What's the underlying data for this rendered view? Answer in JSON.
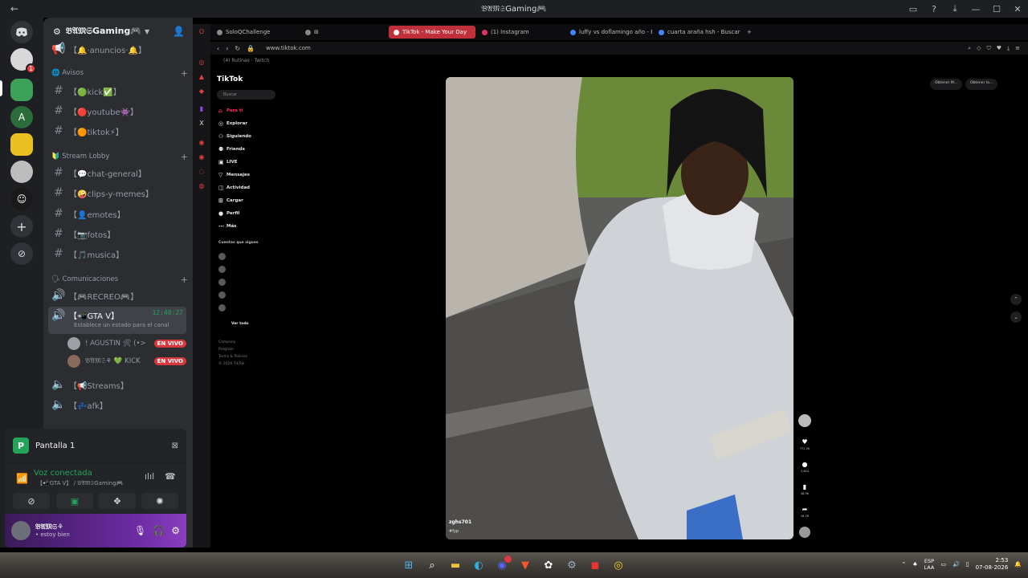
{
  "window": {
    "title": "𝔅𝔄𝔐𝔖Gaming🎮",
    "back_label": "←"
  },
  "server": {
    "name": "𝔅𝔄𝔐𝔖Gaming🎮"
  },
  "rail": {
    "badge_count": "1"
  },
  "channels": {
    "top_partial": "【🔔·anuncios·🔔】",
    "categories": [
      {
        "label": "🌐 Avisos"
      },
      {
        "label": "🔰 Stream Lobby"
      },
      {
        "label": "🗣 Comunicaciones"
      }
    ],
    "avisos": [
      "【🟢kick✅】",
      "【🔴youtube👾】",
      "【🟠tiktok⚡】"
    ],
    "lobby": [
      "【💬chat-general】",
      "【🤪clips-y-memes】",
      "【👤emotes】",
      "【📷fotos】",
      "【🎵musica】"
    ],
    "voice_recreo": "【🎮RECREO🎮】",
    "voice_gta": "【📲GTA V】",
    "voice_gta_timer": "12:48:27",
    "voice_gta_status": "Establece un estado para el canal",
    "voice_users": [
      {
        "name": "! AGUSTIN 🛠 (•>",
        "live": "EN VIVO"
      },
      {
        "name": "𝔅𝔄𝔐𝔖⚘ 💚 KICK",
        "live": "EN VIVO"
      }
    ],
    "voice_streams": "【📢Streams】",
    "voice_afk": "【💤afk】"
  },
  "stream_panel": {
    "name": "Pantalla 1",
    "icon_letter": "P"
  },
  "voice_panel": {
    "status": "Voz conectada",
    "location": "【📲GTA V】 / 𝔅𝔄𝔐𝔖Gaming🎮"
  },
  "user_panel": {
    "name": "𝔅𝔄𝔐𝔖⚘",
    "status": "• estoy bien"
  },
  "browser": {
    "tabs": [
      {
        "label": "SoloQChallenge",
        "color": "#8a8a8a"
      },
      {
        "label": "TikTok - Make Your Day",
        "color": "#ffffff",
        "active": true
      },
      {
        "label": "(1) Instagram",
        "color": "#e1306c"
      },
      {
        "label": "luffy vs doflamingo año - B",
        "color": "#4285f4"
      },
      {
        "label": "cuarta araña hsh - Buscar",
        "color": "#4285f4"
      }
    ],
    "url": "www.tiktok.com",
    "bookmarks": "(4) Rutinas · Twitch"
  },
  "tiktok": {
    "logo": "TikTok",
    "search_placeholder": "Buscar",
    "nav": [
      "Para ti",
      "Explorar",
      "Siguiendo",
      "Friends",
      "LIVE",
      "Mensajes",
      "Actividad",
      "Cargar",
      "Perfil",
      "Más"
    ],
    "following_title": "Cuentas que sigues",
    "following_more": "Ver todo",
    "footer": [
      "Company",
      "Program",
      "Terms & Policies",
      "© 2026 TikTok"
    ],
    "video_user": "zghs701",
    "video_caption": "#fyp",
    "action_counts": [
      "771.2K",
      "3,644",
      "48.9K",
      "26.7K"
    ],
    "top_buttons": [
      "Obtener M...",
      "Obtener la..."
    ]
  },
  "taskbar": {
    "lang_top": "ESP",
    "lang_bottom": "LAA",
    "time": "2:53",
    "date": "07-08-2026",
    "discord_badge": "1"
  },
  "colors": {
    "discord_bg": "#2b2d31",
    "discord_green": "#23a559",
    "live_red": "#da373c",
    "tiktok_red": "#fe2c55",
    "opera_red": "#c0303a"
  }
}
